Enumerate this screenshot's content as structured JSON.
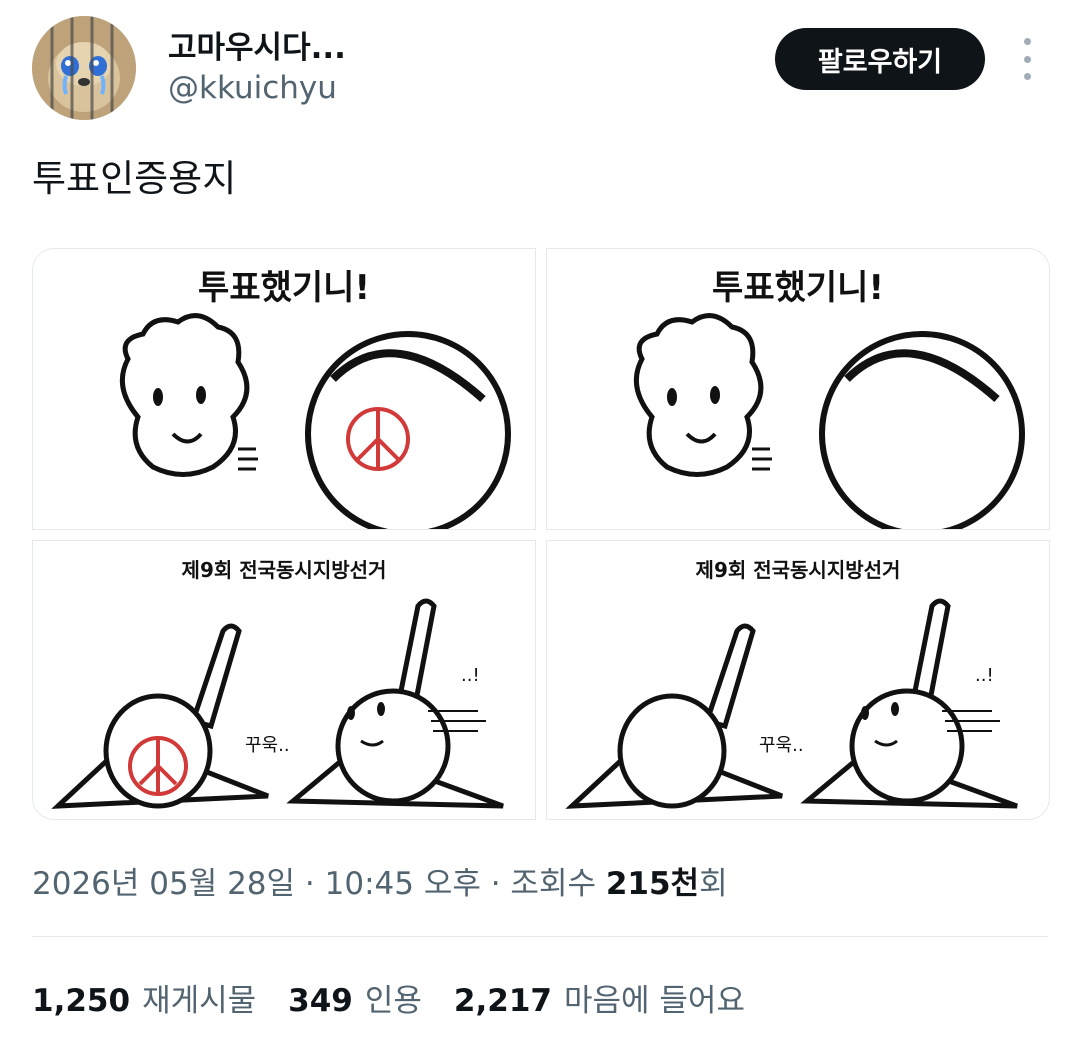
{
  "author": {
    "display_name": "고마우시다...",
    "handle": "@kkuichyu",
    "avatar_icon": "crying-puppy-avatar"
  },
  "follow_label": "팔로우하기",
  "more_icon": "vertical-ellipsis-icon",
  "tweet_text": "투표인증용지",
  "comic": {
    "top_caption": "투표했기니!",
    "bottom_caption": "제9회 전국동시지방선거",
    "sound_squeeze": "꾸욱..",
    "sound_surprise": "..!"
  },
  "meta": {
    "date": "2026년 05월 28일",
    "sep1": " · ",
    "time": "10:45 오후",
    "sep2": " · ",
    "views_label": "조회수 ",
    "views_value": "215천",
    "views_suffix": "회"
  },
  "stats": {
    "retweets_value": "1,250",
    "retweets_label": "재게시물",
    "quotes_value": "349",
    "quotes_label": "인용",
    "likes_value": "2,217",
    "likes_label": "마음에 들어요"
  },
  "colors": {
    "stamp_red": "#d23a3a",
    "button_bg": "#0f1419",
    "secondary_text": "#536471"
  }
}
